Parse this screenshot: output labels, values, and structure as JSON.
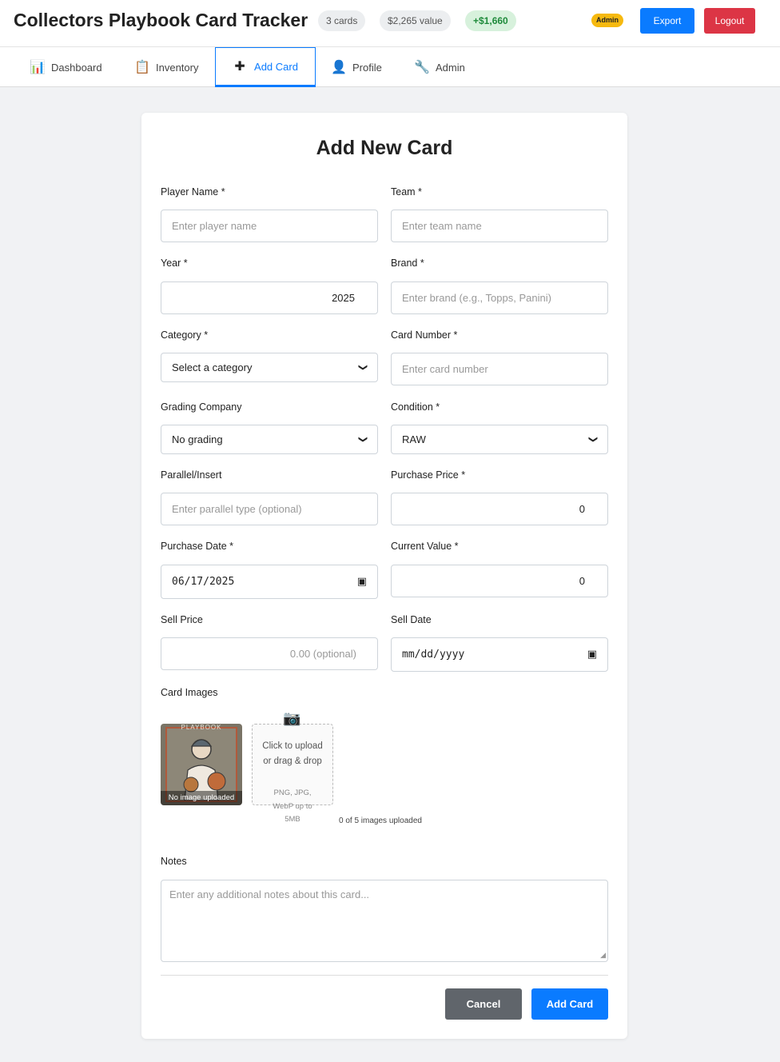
{
  "header": {
    "title": "Collectors Playbook Card Tracker",
    "cards_count": "3 cards",
    "total_value": "$2,265 value",
    "gain": "+$1,660",
    "admin_badge": "Admin",
    "export_label": "Export",
    "logout_label": "Logout"
  },
  "tabs": [
    {
      "label": "Dashboard",
      "icon": "bar-chart-icon",
      "glyph": "📊"
    },
    {
      "label": "Inventory",
      "icon": "clipboard-icon",
      "glyph": "📋"
    },
    {
      "label": "Add Card",
      "icon": "plus-icon",
      "glyph": "✚",
      "active": true
    },
    {
      "label": "Profile",
      "icon": "user-icon",
      "glyph": "👤"
    },
    {
      "label": "Admin",
      "icon": "wrench-icon",
      "glyph": "🔧"
    }
  ],
  "form": {
    "title": "Add New Card",
    "player_name": {
      "label": "Player Name *",
      "placeholder": "Enter player name"
    },
    "team": {
      "label": "Team *",
      "placeholder": "Enter team name"
    },
    "year": {
      "label": "Year *",
      "value": "2025"
    },
    "brand": {
      "label": "Brand *",
      "placeholder": "Enter brand (e.g., Topps, Panini)"
    },
    "category": {
      "label": "Category *",
      "value": "Select a category"
    },
    "card_number": {
      "label": "Card Number *",
      "placeholder": "Enter card number"
    },
    "grading_company": {
      "label": "Grading Company",
      "value": "No grading"
    },
    "condition": {
      "label": "Condition *",
      "value": "RAW"
    },
    "parallel": {
      "label": "Parallel/Insert",
      "placeholder": "Enter parallel type (optional)"
    },
    "purchase_price": {
      "label": "Purchase Price *",
      "value": "0"
    },
    "purchase_date": {
      "label": "Purchase Date *",
      "value": "06/17/2025"
    },
    "current_value": {
      "label": "Current Value *",
      "value": "0"
    },
    "sell_price": {
      "label": "Sell Price",
      "placeholder": "0.00 (optional)"
    },
    "sell_date": {
      "label": "Sell Date",
      "value": "mm/dd/yyyy"
    },
    "images": {
      "label": "Card Images",
      "thumb_logo": "PLAYBOOK",
      "thumb_caption": "No image uploaded",
      "upload_text": "Click to upload or drag & drop",
      "upload_hint": "PNG, JPG, WebP up to 5MB",
      "count_text": "0 of 5 images uploaded"
    },
    "notes": {
      "label": "Notes",
      "placeholder": "Enter any additional notes about this card..."
    },
    "cancel_label": "Cancel",
    "submit_label": "Add Card"
  },
  "colors": {
    "primary": "#0a7bff",
    "danger": "#dc3545",
    "secondary": "#60656b",
    "success_bg": "#d7f1dc",
    "success_text": "#1e8a3a",
    "admin_badge": "#f6b90f"
  }
}
